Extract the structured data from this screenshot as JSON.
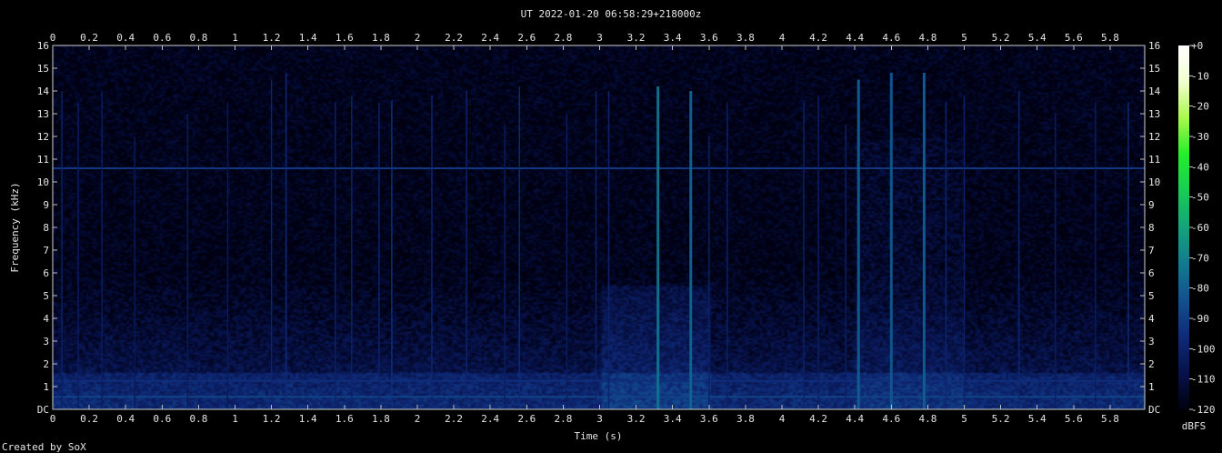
{
  "chart_data": {
    "type": "heatmap",
    "title": "UT 2022-01-20 06:58:29+218000z",
    "xlabel": "Time (s)",
    "ylabel": "Frequency (kHz)",
    "xlim": [
      0,
      5.99
    ],
    "ylim": [
      0,
      16
    ],
    "x_ticks": [
      "0",
      "0.2",
      "0.4",
      "0.6",
      "0.8",
      "1",
      "1.2",
      "1.4",
      "1.6",
      "1.8",
      "2",
      "2.2",
      "2.4",
      "2.6",
      "2.8",
      "3",
      "3.2",
      "3.4",
      "3.6",
      "3.8",
      "4",
      "4.2",
      "4.4",
      "4.6",
      "4.8",
      "5",
      "5.2",
      "5.4",
      "5.6",
      "5.8"
    ],
    "y_ticks": [
      "DC",
      "1",
      "2",
      "3",
      "4",
      "5",
      "6",
      "7",
      "8",
      "9",
      "10",
      "11",
      "12",
      "13",
      "14",
      "15",
      "16"
    ],
    "colorbar": {
      "label": "dBFS",
      "ticks": [
        "+0",
        "-10",
        "-20",
        "-30",
        "-40",
        "-50",
        "-60",
        "-70",
        "-80",
        "-90",
        "-100",
        "-110",
        "-120"
      ],
      "range": [
        -120,
        0
      ],
      "colors": [
        "#000010",
        "#07124a",
        "#0f2a78",
        "#12508f",
        "#127a8f",
        "#14a37a",
        "#18cc55",
        "#23ee2a",
        "#a8f84a",
        "#f2ffd0",
        "#ffffff"
      ]
    },
    "background_colors": [
      "#000000",
      "#02061c",
      "#04103a",
      "#0a1f5e",
      "#0f3a7e",
      "#135f92",
      "#1a8f8a",
      "#2fc27a"
    ],
    "horizontal_lines_khz": [
      {
        "freq": 0.55,
        "level": -88
      },
      {
        "freq": 1.25,
        "level": -95
      },
      {
        "freq": 10.6,
        "level": -92
      }
    ],
    "vertical_events": [
      {
        "t": 0.05,
        "fmax": 14.0,
        "level": -100
      },
      {
        "t": 0.14,
        "fmax": 13.5,
        "level": -102
      },
      {
        "t": 0.27,
        "fmax": 14.0,
        "level": -102
      },
      {
        "t": 0.45,
        "fmax": 12.0,
        "level": -104
      },
      {
        "t": 0.74,
        "fmax": 13.0,
        "level": -103
      },
      {
        "t": 0.96,
        "fmax": 13.5,
        "level": -104
      },
      {
        "t": 1.2,
        "fmax": 14.5,
        "level": -98
      },
      {
        "t": 1.28,
        "fmax": 14.8,
        "level": -96
      },
      {
        "t": 1.55,
        "fmax": 13.5,
        "level": -100
      },
      {
        "t": 1.64,
        "fmax": 13.8,
        "level": -99
      },
      {
        "t": 1.79,
        "fmax": 13.5,
        "level": -99
      },
      {
        "t": 1.86,
        "fmax": 13.6,
        "level": -94
      },
      {
        "t": 2.08,
        "fmax": 13.8,
        "level": -98
      },
      {
        "t": 2.27,
        "fmax": 14.0,
        "level": -99
      },
      {
        "t": 2.48,
        "fmax": 12.5,
        "level": -102
      },
      {
        "t": 2.56,
        "fmax": 14.2,
        "level": -96
      },
      {
        "t": 2.82,
        "fmax": 13.0,
        "level": -102
      },
      {
        "t": 2.98,
        "fmax": 14.0,
        "level": -99
      },
      {
        "t": 3.05,
        "fmax": 14.0,
        "level": -99
      },
      {
        "t": 3.32,
        "fmax": 14.2,
        "level": -74
      },
      {
        "t": 3.5,
        "fmax": 14.0,
        "level": -78
      },
      {
        "t": 3.6,
        "fmax": 12.0,
        "level": -100
      },
      {
        "t": 3.7,
        "fmax": 13.5,
        "level": -100
      },
      {
        "t": 4.12,
        "fmax": 13.5,
        "level": -100
      },
      {
        "t": 4.2,
        "fmax": 13.8,
        "level": -101
      },
      {
        "t": 4.35,
        "fmax": 12.5,
        "level": -101
      },
      {
        "t": 4.42,
        "fmax": 14.5,
        "level": -80
      },
      {
        "t": 4.6,
        "fmax": 14.8,
        "level": -82
      },
      {
        "t": 4.78,
        "fmax": 14.8,
        "level": -80
      },
      {
        "t": 4.9,
        "fmax": 13.5,
        "level": -98
      },
      {
        "t": 5.0,
        "fmax": 13.8,
        "level": -100
      },
      {
        "t": 5.3,
        "fmax": 14.0,
        "level": -98
      },
      {
        "t": 5.5,
        "fmax": 13.0,
        "level": -102
      },
      {
        "t": 5.72,
        "fmax": 13.5,
        "level": -102
      },
      {
        "t": 5.9,
        "fmax": 13.5,
        "level": -96
      }
    ],
    "grid": false,
    "legend": "none",
    "footer": "Created by SoX"
  }
}
